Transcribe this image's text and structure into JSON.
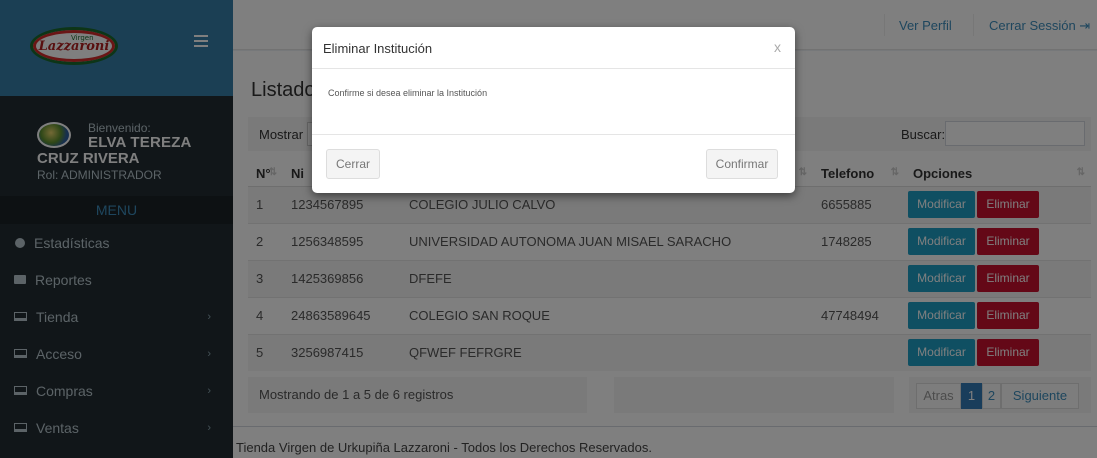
{
  "brand": {
    "logo_text": "Lazzaroni",
    "logo_small": "Virgen"
  },
  "user": {
    "welcome": "Bienvenido:",
    "name_line1": "ELVA TEREZA",
    "name_line2": "CRUZ RIVERA",
    "role": "Rol: ADMINISTRADOR"
  },
  "sidebar": {
    "menu_header": "MENU",
    "items": [
      {
        "label": "Estadísticas",
        "icon": "dashboard-icon",
        "has_children": false
      },
      {
        "label": "Reportes",
        "icon": "folder-icon",
        "has_children": false
      },
      {
        "label": "Tienda",
        "icon": "laptop-icon",
        "has_children": true
      },
      {
        "label": "Acceso",
        "icon": "laptop-icon",
        "has_children": true
      },
      {
        "label": "Compras",
        "icon": "laptop-icon",
        "has_children": true
      },
      {
        "label": "Ventas",
        "icon": "laptop-icon",
        "has_children": true
      }
    ],
    "chevron": "›"
  },
  "header": {
    "profile_link": "Ver Perfil",
    "logout_link": "Cerrar Sessión",
    "logout_icon": "⇥"
  },
  "main": {
    "title": "Listado",
    "show_label": "Mostrar",
    "search_label": "Buscar:",
    "columns": [
      "N°",
      "Ni",
      "",
      "Telefono",
      "Opciones"
    ],
    "rows": [
      {
        "n": "1",
        "nit": "1234567895",
        "nombre": "COLEGIO JULIO CALVO",
        "telefono": "6655885"
      },
      {
        "n": "2",
        "nit": "1256348595",
        "nombre": "UNIVERSIDAD AUTONOMA JUAN MISAEL SARACHO",
        "telefono": "1748285"
      },
      {
        "n": "3",
        "nit": "1425369856",
        "nombre": "DFEFE",
        "telefono": ""
      },
      {
        "n": "4",
        "nit": "24863589645",
        "nombre": "COLEGIO SAN ROQUE",
        "telefono": "47748494"
      },
      {
        "n": "5",
        "nit": "3256987415",
        "nombre": "QFWEF FEFRGRE",
        "telefono": ""
      }
    ],
    "modify_label": "Modificar",
    "delete_label": "Eliminar",
    "info": "Mostrando de 1 a 5 de 6 registros",
    "pager": {
      "prev": "Atras",
      "pages": [
        "1",
        "2"
      ],
      "next": "Siguiente"
    }
  },
  "footer": {
    "text": "Tienda Virgen de Urkupiña Lazzaroni - Todos los Derechos Reservados."
  },
  "modal": {
    "title": "Eliminar Institución",
    "close_glyph": "x",
    "message": "Confirme si desea eliminar la Institución",
    "cancel_label": "Cerrar",
    "confirm_label": "Confirmar"
  },
  "colors": {
    "sidebar_bg": "#222d32",
    "logo_bar": "#367fa9",
    "modify_button": "#1e9ec4",
    "delete_button": "#c8102e",
    "active_page": "#337ab7"
  }
}
